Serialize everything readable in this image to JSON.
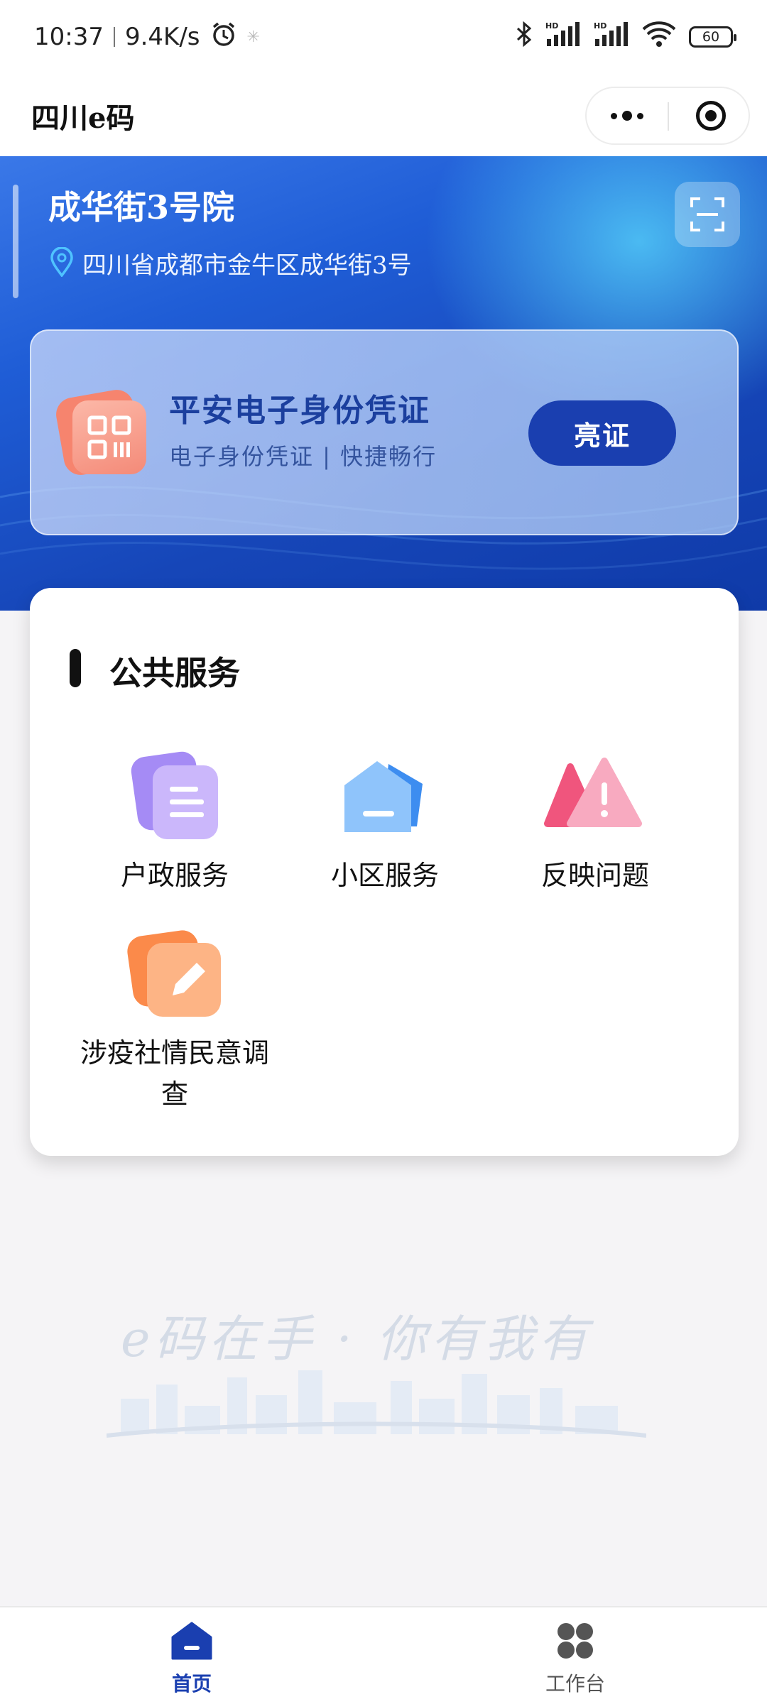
{
  "status_bar": {
    "time": "10:37",
    "speed": "9.4K/s",
    "battery": "60"
  },
  "header": {
    "title": "四川e码"
  },
  "location": {
    "name": "成华街3号院",
    "address": "四川省成都市金牛区成华街3号"
  },
  "id_card": {
    "title": "平安电子身份凭证",
    "subtitle": "电子身份凭证 | 快捷畅行",
    "button": "亮证"
  },
  "services": {
    "title": "公共服务",
    "items": [
      {
        "label": "户政服务",
        "icon": "household-icon"
      },
      {
        "label": "小区服务",
        "icon": "community-icon"
      },
      {
        "label": "反映问题",
        "icon": "report-issue-icon"
      },
      {
        "label": "涉疫社情民意调查",
        "icon": "survey-icon"
      }
    ]
  },
  "watermark": {
    "slogan": "e码在手 · 你有我有"
  },
  "nav": {
    "home": "首页",
    "workbench": "工作台"
  },
  "colors": {
    "brand_blue": "#1a3fb0",
    "hero_blue": "#1f5dd6",
    "nav_active": "#1a3fb0",
    "nav_inactive": "#555555"
  }
}
